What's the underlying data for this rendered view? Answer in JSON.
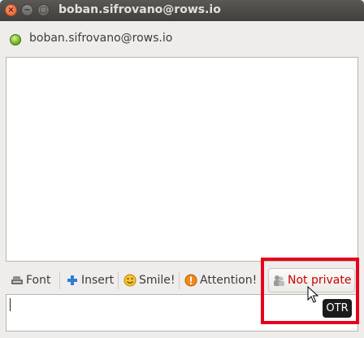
{
  "window": {
    "title": "boban.sifrovano@rows.io",
    "close_glyph": "×",
    "minimize_glyph": "−",
    "maximize_glyph": "□"
  },
  "contact": {
    "name": "boban.sifrovano@rows.io",
    "status_color": "#6fb31f"
  },
  "toolbar": {
    "font_label": "Font",
    "insert_label": "Insert",
    "smile_label": "Smile!",
    "attention_label": "Attention!",
    "private_label": "Not private",
    "private_color": "#cc0000"
  },
  "icons": {
    "font": "font-icon",
    "insert": "plus-icon",
    "smile": "smiley-icon",
    "attention": "exclamation-icon",
    "private": "people-icon"
  },
  "tooltip": {
    "text": "OTR"
  },
  "highlight_color": "#e8001c"
}
